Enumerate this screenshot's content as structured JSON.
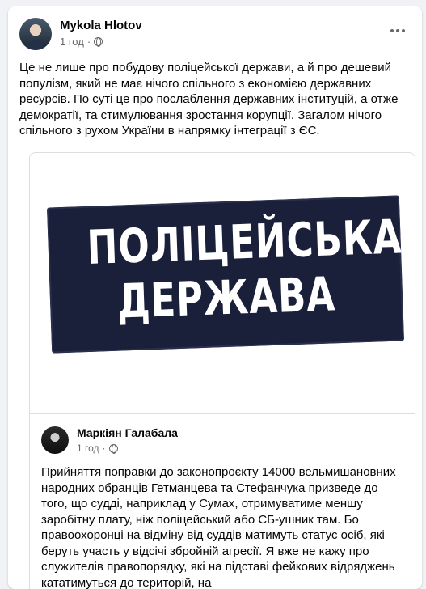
{
  "post": {
    "author": "Mykola Hlotov",
    "time": "1 год",
    "text": "Це не лише про побудову поліцейської держави, а й про дешевий популізм, який не має нічого спільного з економією державних ресурсів. По суті це про послаблення державних інституцій, а отже демократії, та стимулювання зростання корупції. Загалом нічого спільного з рухом України в напрямку інтеграції з ЄС."
  },
  "shared": {
    "image_text_line1": "ПОЛІЦЕЙСЬКА",
    "image_text_line2": "ДЕРЖАВА",
    "author": "Маркіян Галабала",
    "time": "1 год",
    "text": "Прийняття поправки до законопроєкту 14000 вельмишановних народних обранців Гетманцева та Стефанчука призведе до того, що судді, наприклад у Сумах, отримуватиме меншу заробітну плату, ніж поліцейський або СБ-ушник там. Бо правоохоронці на відміну від суддів матимуть статус осіб, які беруть участь у відсічі збройній агресії. Я вже не кажу про служителів правопорядку, які на підставі фейкових відряджень кататимуться до територій, на"
  },
  "icons": {
    "more": "more-options-icon",
    "audience": "globe-icon"
  },
  "colors": {
    "page_bg": "#f0f2f5",
    "card_bg": "#ffffff",
    "secondary_text": "#65676b",
    "stamp_bg": "#1a1f3a"
  }
}
